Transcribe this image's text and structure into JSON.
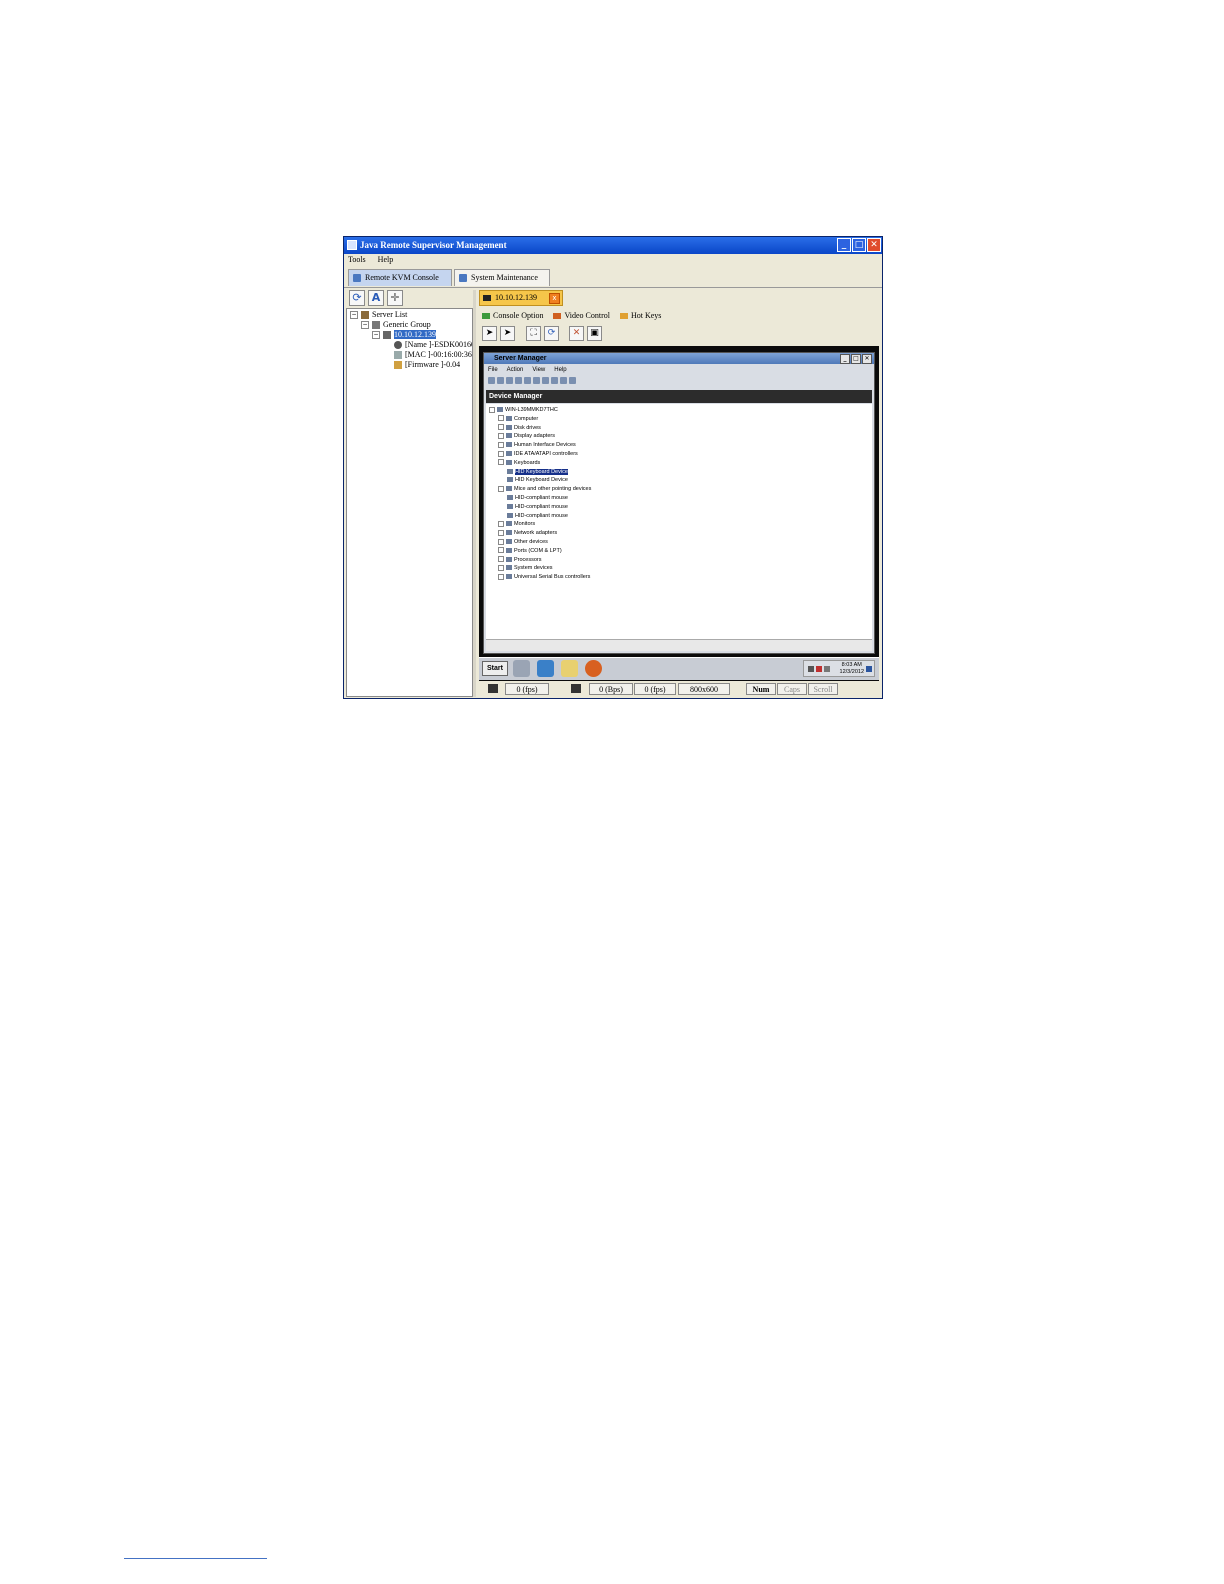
{
  "window": {
    "title": "Java Remote Supervisor Management",
    "controls": [
      "_",
      "□",
      "✕"
    ]
  },
  "menu": [
    "Tools",
    "Help"
  ],
  "tabs": [
    {
      "label": "Remote KVM Console",
      "icon": "console-icon",
      "active": true
    },
    {
      "label": "System Maintenance",
      "icon": "maintenance-icon",
      "active": false
    }
  ],
  "left_toolbar": [
    "refresh-icon",
    "font-icon",
    "add-icon"
  ],
  "tree": {
    "root": "Server List",
    "group": "Generic Group",
    "device": "10.10.12.139",
    "name": "[Name ]-ESDK00160",
    "mac": "[MAC ]-00:16:00:36",
    "firmware": "[Firmware ]-0.04"
  },
  "device_tab": {
    "label": "10.10.12.139",
    "close": "x"
  },
  "console_menu": [
    {
      "label": "Console Option",
      "color": "#3c9a3c"
    },
    {
      "label": "Video Control",
      "color": "#d06020"
    },
    {
      "label": "Hot Keys",
      "color": "#e0a030"
    }
  ],
  "console_toolbar": [
    "cursor-icon",
    "cursor-sync-icon",
    "fullscreen-icon",
    "refresh-screen-icon",
    "close-icon",
    "capture-icon"
  ],
  "remote": {
    "window_title": "Server Manager",
    "menu": [
      "File",
      "Action",
      "View",
      "Help"
    ],
    "header": "Device Manager",
    "items": [
      {
        "label": "WIN-L39MMKD7THC",
        "level": 0
      },
      {
        "label": "Computer",
        "level": 1
      },
      {
        "label": "Disk drives",
        "level": 1
      },
      {
        "label": "Display adapters",
        "level": 1
      },
      {
        "label": "Human Interface Devices",
        "level": 1
      },
      {
        "label": "IDE ATA/ATAPI controllers",
        "level": 1
      },
      {
        "label": "Keyboards",
        "level": 1
      },
      {
        "label": "HID Keyboard Device",
        "level": 2,
        "selected": true
      },
      {
        "label": "HID Keyboard Device",
        "level": 2
      },
      {
        "label": "Mice and other pointing devices",
        "level": 1
      },
      {
        "label": "HID-compliant mouse",
        "level": 2
      },
      {
        "label": "HID-compliant mouse",
        "level": 2
      },
      {
        "label": "HID-compliant mouse",
        "level": 2
      },
      {
        "label": "Monitors",
        "level": 1
      },
      {
        "label": "Network adapters",
        "level": 1
      },
      {
        "label": "Other devices",
        "level": 1
      },
      {
        "label": "Ports (COM & LPT)",
        "level": 1
      },
      {
        "label": "Processors",
        "level": 1
      },
      {
        "label": "System devices",
        "level": 1
      },
      {
        "label": "Universal Serial Bus controllers",
        "level": 1
      }
    ],
    "start": "Start",
    "clock_time": "8:03 AM",
    "clock_date": "12/3/2012"
  },
  "status": {
    "fps1": "0 (fps)",
    "fps2": "0 (Bps)",
    "fps3": "0 (fps)",
    "resolution": "800x600",
    "num": "Num",
    "caps": "Caps",
    "scroll": "Scroll"
  }
}
